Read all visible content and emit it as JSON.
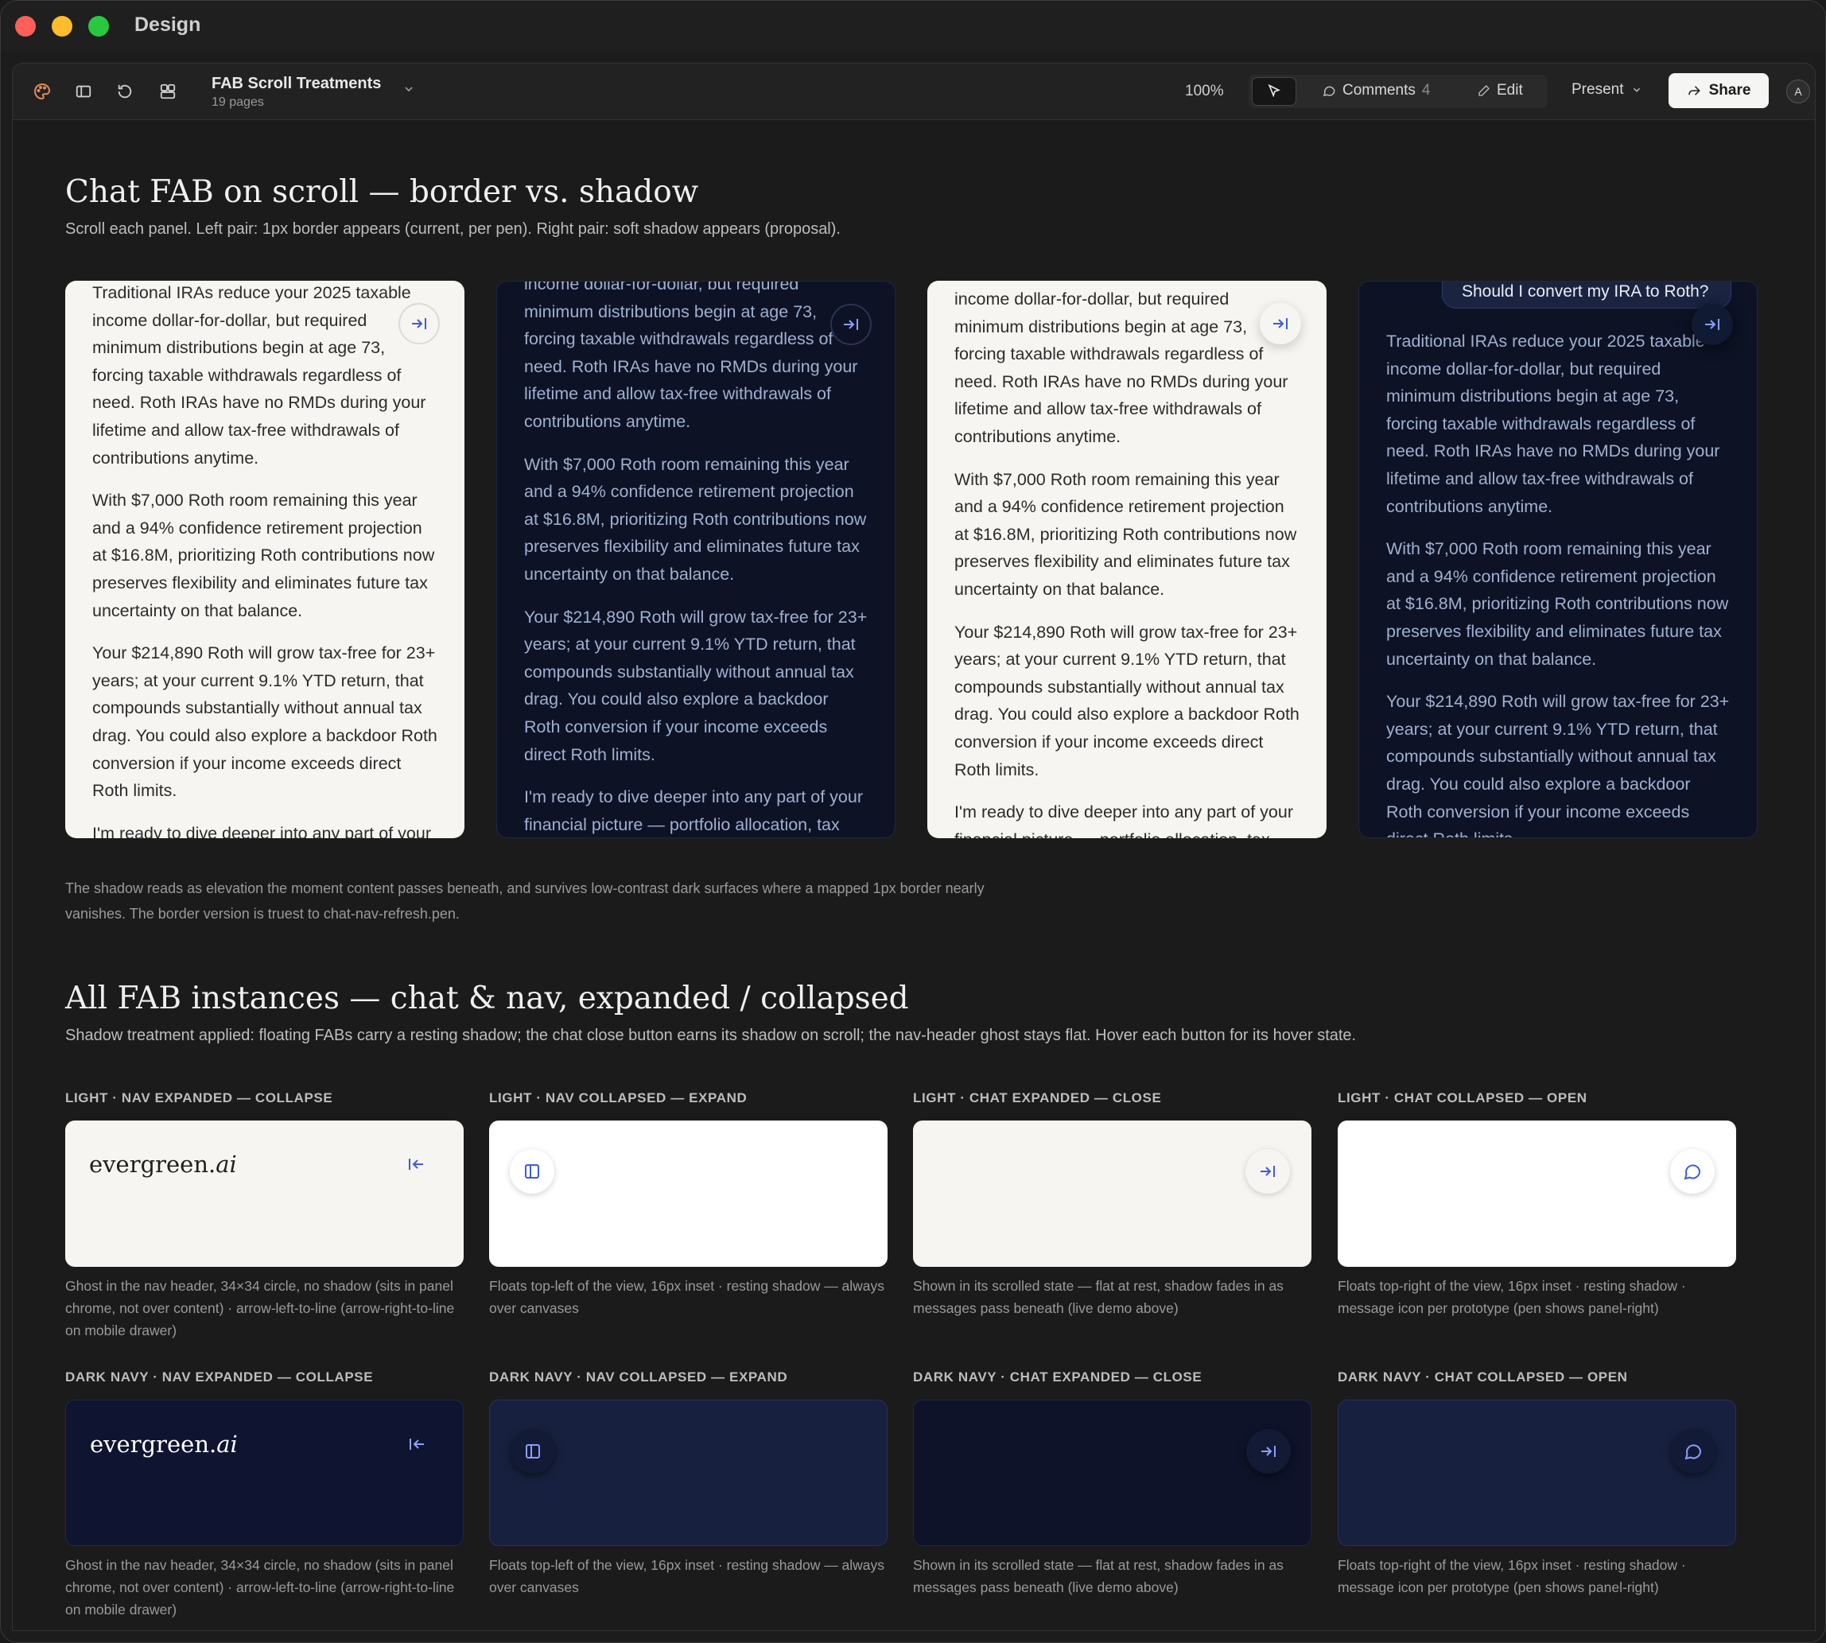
{
  "window": {
    "title": "Design"
  },
  "toolbar": {
    "doc_title": "FAB Scroll Treatments",
    "doc_pages": "19 pages",
    "zoom": "100%",
    "comments_label": "Comments",
    "comments_count": "4",
    "edit_label": "Edit",
    "present_label": "Present",
    "share_label": "Share",
    "avatar_initial": "A"
  },
  "section1": {
    "title": "Chat FAB on scroll — border vs. shadow",
    "lead": "Scroll each panel. Left pair: 1px border appears (current, per pen). Right pair: soft shadow appears (proposal).",
    "user_question": "Should I convert my IRA to Roth?",
    "p1": "Traditional IRAs reduce your 2025 taxable income dollar-for-dollar, but required minimum distributions begin at age 73, forcing taxable withdrawals regardless of need. Roth IRAs have no RMDs during your lifetime and allow tax-free withdrawals of contributions anytime.",
    "p1_tail": "income dollar-for-dollar, but required minimum distributions begin at age 73, forcing taxable withdrawals regardless of need. Roth IRAs have no RMDs during your lifetime and allow tax-free withdrawals of contributions anytime.",
    "p2": "With $7,000 Roth room remaining this year and a 94% confidence retirement projection at $16.8M, prioritizing Roth contributions now preserves flexibility and eliminates future tax uncertainty on that balance.",
    "p3": "Your $214,890 Roth will grow tax-free for 23+ years; at your current 9.1% YTD return, that compounds substantially without annual tax drag. You could also explore a backdoor Roth conversion if your income exceeds direct Roth limits.",
    "p4": "I'm ready to dive deeper into any part of your financial picture — portfolio allocation, tax strategy, or retirement planning.",
    "footnote": "The shadow reads as elevation the moment content passes beneath, and survives low-contrast dark surfaces where a mapped 1px border nearly vanishes. The border version is truest to chat-nav-refresh.pen."
  },
  "section2": {
    "title": "All FAB instances — chat & nav, expanded / collapsed",
    "lead": "Shadow treatment applied: floating FABs carry a resting shadow; the chat close button earns its shadow on scroll; the nav-header ghost stays flat. Hover each button for its hover state.",
    "brand_main": "evergreen.",
    "brand_ai": "ai",
    "light": [
      {
        "label": "LIGHT · NAV EXPANDED — COLLAPSE",
        "desc": "Ghost in the nav header, 34×34 circle, no shadow (sits in panel chrome, not over content) · arrow-left-to-line (arrow-right-to-line on mobile drawer)"
      },
      {
        "label": "LIGHT · NAV COLLAPSED — EXPAND",
        "desc": "Floats top-left of the view, 16px inset · resting shadow — always over canvases"
      },
      {
        "label": "LIGHT · CHAT EXPANDED — CLOSE",
        "desc": "Shown in its scrolled state — flat at rest, shadow fades in as messages pass beneath (live demo above)"
      },
      {
        "label": "LIGHT · CHAT COLLAPSED — OPEN",
        "desc": "Floats top-right of the view, 16px inset · resting shadow · message icon per prototype (pen shows panel-right)"
      }
    ],
    "dark": [
      {
        "label": "DARK NAVY · NAV EXPANDED — COLLAPSE",
        "desc": "Ghost in the nav header, 34×34 circle, no shadow (sits in panel chrome, not over content) · arrow-left-to-line (arrow-right-to-line on mobile drawer)"
      },
      {
        "label": "DARK NAVY · NAV COLLAPSED — EXPAND",
        "desc": "Floats top-left of the view, 16px inset · resting shadow — always over canvases"
      },
      {
        "label": "DARK NAVY · CHAT EXPANDED — CLOSE",
        "desc": "Shown in its scrolled state — flat at rest, shadow fades in as messages pass beneath (live demo above)"
      },
      {
        "label": "DARK NAVY · CHAT COLLAPSED — OPEN",
        "desc": "Floats top-right of the view, 16px inset · resting shadow · message icon per prototype (pen shows panel-right)"
      }
    ]
  },
  "colors": {
    "accent_blue": "#3d5bd9",
    "accent_blue_dark": "#8aa0ff",
    "navy": "#0d1325",
    "cream": "#f6f5f1"
  },
  "icons": {
    "toolbar": [
      "palette-icon",
      "sidebar-icon",
      "refresh-icon",
      "components-icon",
      "chevron-down-icon",
      "pointer-icon",
      "comment-icon",
      "pencil-icon",
      "share-arrow-icon"
    ],
    "fabs": [
      "arrow-right-to-line-icon",
      "arrow-left-to-line-icon",
      "panel-left-icon",
      "message-circle-icon"
    ]
  }
}
